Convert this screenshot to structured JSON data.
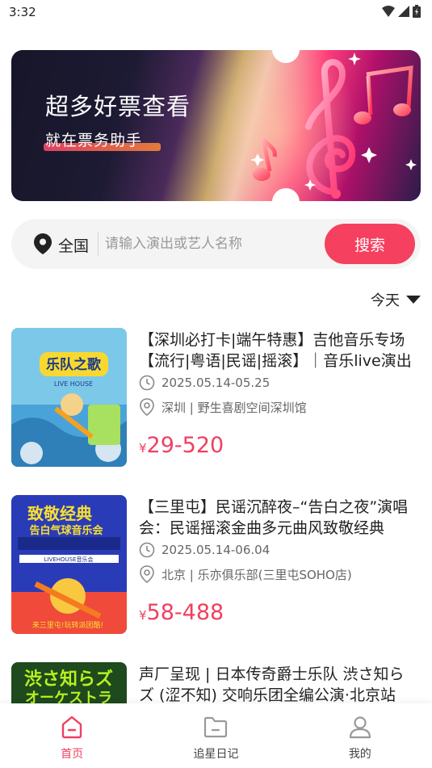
{
  "status_bar": {
    "time": "3:32"
  },
  "banner": {
    "title": "超多好票查看",
    "subtitle": "就在票务助手"
  },
  "search": {
    "location": "全国",
    "placeholder": "请输入演出或艺人名称",
    "button_label": "搜索"
  },
  "date_filter": {
    "label": "今天"
  },
  "events": [
    {
      "title": "【深圳必打卡|端午特惠】吉他音乐专场【流行|粤语|民谣|摇滚】｜音乐live演出",
      "date": "2025.05.14-05.25",
      "venue": "深圳 | 野生喜剧空间深圳馆",
      "currency": "¥",
      "price": "29-520",
      "poster_text": "乐队之歌"
    },
    {
      "title": "【三里屯】民谣沉醉夜–“告白之夜”演唱会：民谣摇滚金曲多元曲风致敬经典",
      "date": "2025.05.14-06.04",
      "venue": "北京 | 乐亦俱乐部(三里屯SOHO店)",
      "currency": "¥",
      "price": "58-488",
      "poster_text": "致敬经典"
    },
    {
      "title": "声厂呈现 | 日本传奇爵士乐队 渋さ知らズ (涩不知) 交响乐团全编公演·北京站",
      "date": "",
      "venue": "",
      "currency": "",
      "price": "",
      "poster_text": "渋さ知らズ"
    }
  ],
  "bottom_nav": [
    {
      "label": "首页",
      "active": true
    },
    {
      "label": "追星日记",
      "active": false
    },
    {
      "label": "我的",
      "active": false
    }
  ],
  "colors": {
    "accent": "#f5405f",
    "price": "#f04060"
  }
}
